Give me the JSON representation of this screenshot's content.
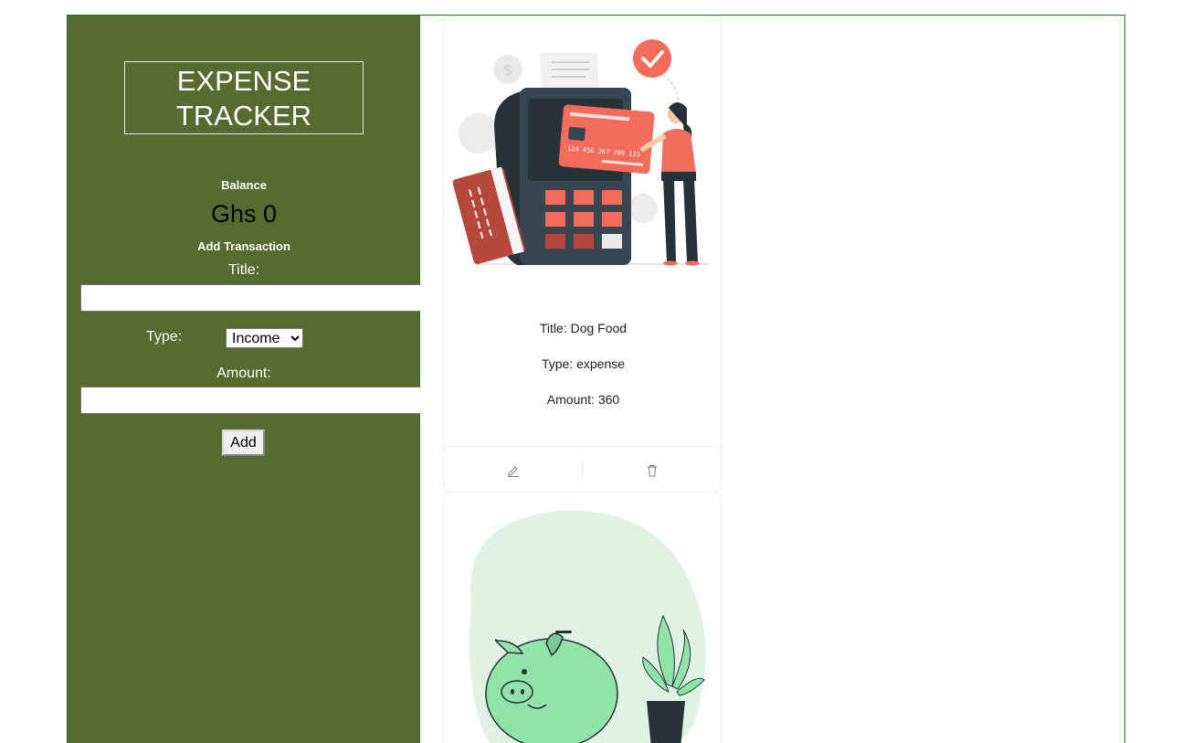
{
  "sidebar": {
    "title_line1": "EXPENSE",
    "title_line2": "TRACKER",
    "balance_label": "Balance",
    "balance_value": "Ghs 0",
    "add_transaction_label": "Add Transaction",
    "title_field_label": "Title:",
    "title_field_value": "",
    "type_field_label": "Type:",
    "type_selected": "Income",
    "amount_field_label": "Amount:",
    "amount_field_value": "",
    "add_button_label": "Add"
  },
  "transactions": [
    {
      "title_text": "Title: Dog Food",
      "type_text": "Type: expense",
      "amount_text": "Amount: 360",
      "illustration": "card-payment-illustration",
      "edit_icon": "pencil-icon",
      "delete_icon": "trash-icon"
    },
    {
      "illustration": "piggy-bank-illustration"
    }
  ],
  "colors": {
    "sidebar_bg": "#556b2f",
    "border": "#1f7a1f",
    "accent_coral": "#f26b5b",
    "accent_green": "#92e3a9"
  }
}
